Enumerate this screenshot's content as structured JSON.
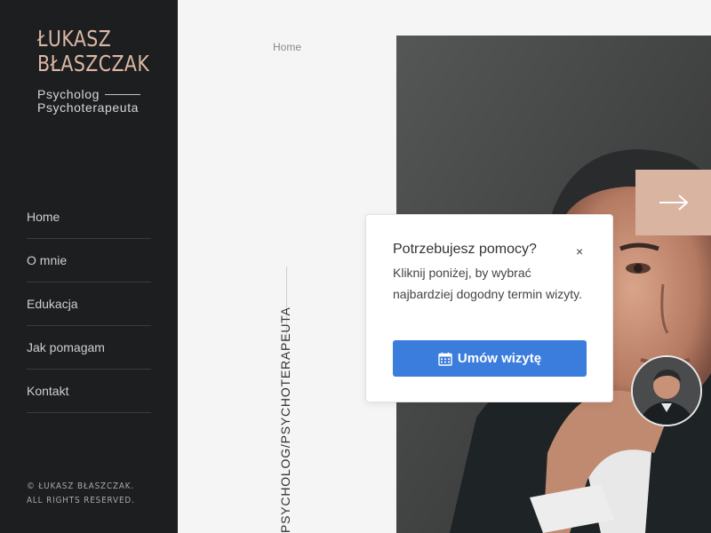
{
  "brand": {
    "name_line1": "ŁUKASZ",
    "name_line2": "BŁASZCZAK",
    "subtitle_line1": "Psycholog",
    "subtitle_line2": "Psychoterapeuta"
  },
  "nav": {
    "items": [
      {
        "label": "Home"
      },
      {
        "label": "O mnie"
      },
      {
        "label": "Edukacja"
      },
      {
        "label": "Jak pomagam"
      },
      {
        "label": "Kontakt"
      }
    ]
  },
  "footer": {
    "copyright_line1": "© ŁUKASZ BŁASZCZAK.",
    "copyright_line2": "ALL RIGHTS RESERVED."
  },
  "main": {
    "breadcrumb": "Home",
    "vertical_text": "PSYCHOLOG/PSYCHOTERAPEUTA"
  },
  "popup": {
    "title": "Potrzebujesz pomocy?",
    "close": "×",
    "text": "Kliknij poniżej, by wybrać najbardziej dogodny termin wizyty.",
    "button": "Umów wizytę"
  },
  "icons": {
    "next": "arrow-right-icon",
    "calendar": "calendar-icon",
    "close": "close-icon"
  },
  "colors": {
    "sidebar_bg": "#1d1e20",
    "brand_accent": "#dcb8a4",
    "next_button": "#d9b4a1",
    "cta_button": "#3b7ddd"
  }
}
